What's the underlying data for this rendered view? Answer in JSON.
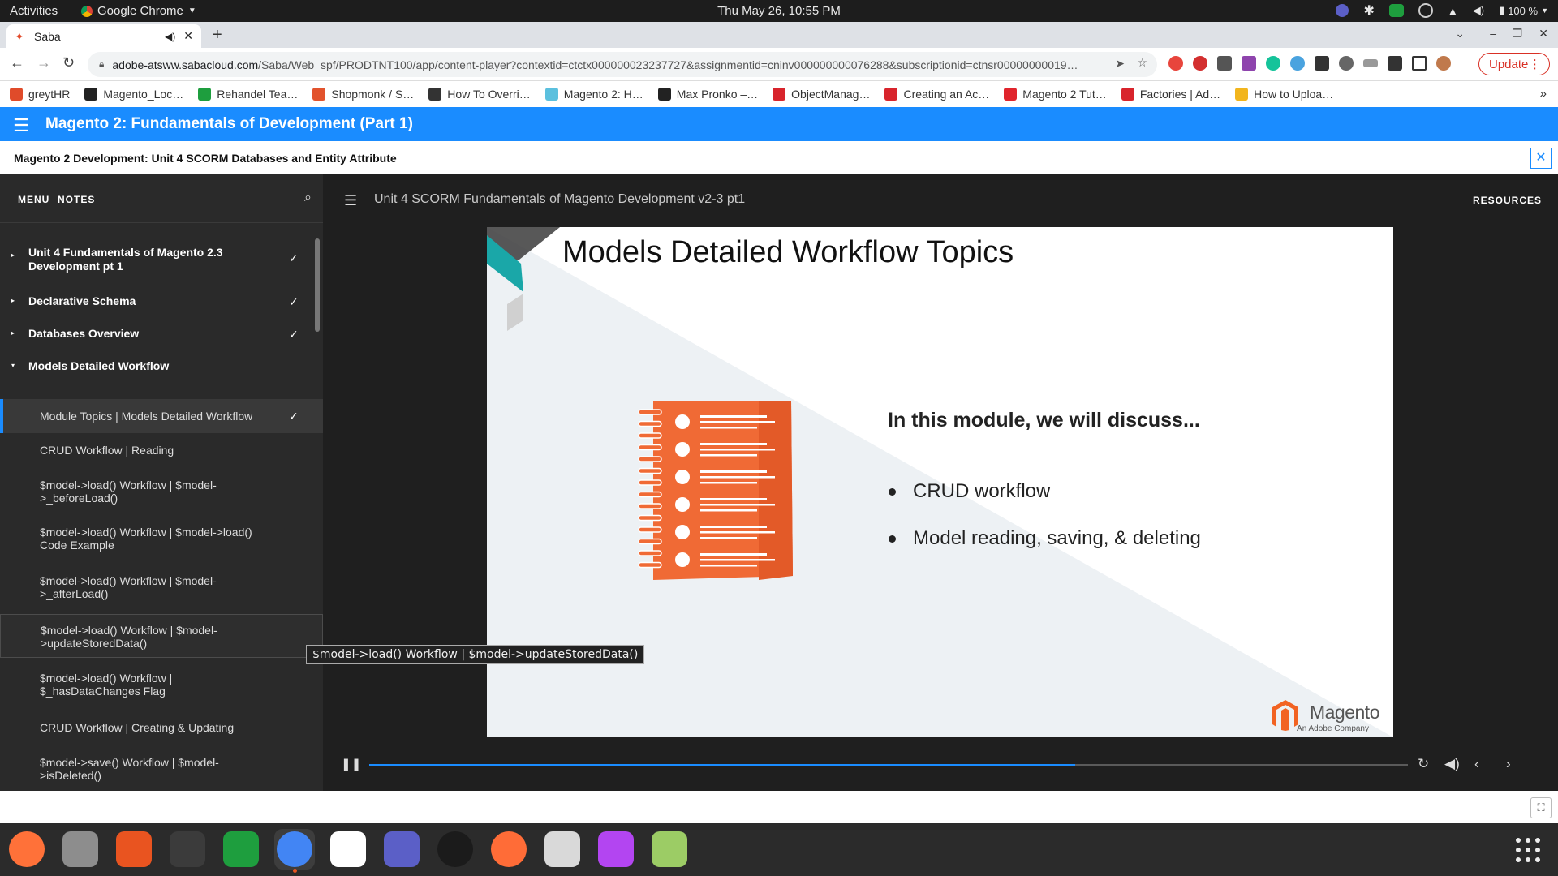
{
  "system": {
    "activities": "Activities",
    "app_name": "Google Chrome",
    "clock": "Thu May 26, 10:55 PM",
    "battery": "100 %"
  },
  "browser": {
    "tab_title": "Saba",
    "url_host": "adobe-atsww.sabacloud.com",
    "url_path": "/Saba/Web_spf/PRODTNT100/app/content-player?contextid=ctctx000000023237727&assignmentid=cninv000000000076288&subscriptionid=ctnsr00000000019…",
    "update_label": "Update",
    "bookmarks": [
      {
        "label": "greytHR",
        "color": "#e04b2a"
      },
      {
        "label": "Magento_Loc…",
        "color": "#222222"
      },
      {
        "label": "Rehandel Tea…",
        "color": "#1e9e3e"
      },
      {
        "label": "Shopmonk / S…",
        "color": "#e2532d"
      },
      {
        "label": "How To Overri…",
        "color": "#333333"
      },
      {
        "label": "Magento 2: H…",
        "color": "#5bc0de"
      },
      {
        "label": "Max Pronko –…",
        "color": "#222222"
      },
      {
        "label": "ObjectManag…",
        "color": "#d8242c"
      },
      {
        "label": "Creating an Ac…",
        "color": "#d8242c"
      },
      {
        "label": "Magento 2 Tut…",
        "color": "#e0242c"
      },
      {
        "label": "Factories | Ad…",
        "color": "#d8242c"
      },
      {
        "label": "How to Uploa…",
        "color": "#f2b51d"
      }
    ]
  },
  "course": {
    "title": "Magento 2: Fundamentals of Development (Part 1)",
    "module_title": "Magento 2 Development: Unit 4 SCORM Databases and Entity Attribute"
  },
  "sidebar": {
    "tab_menu": "MENU",
    "tab_notes": "NOTES",
    "sections": [
      {
        "label": "Unit 4 Fundamentals of Magento 2.3 Development pt 1",
        "caret": "▸",
        "check": "✓"
      },
      {
        "label": "Declarative Schema",
        "caret": "▸",
        "check": "✓"
      },
      {
        "label": "Databases Overview",
        "caret": "▸",
        "check": "✓"
      },
      {
        "label": "Models Detailed Workflow",
        "caret": "▾",
        "check": ""
      }
    ],
    "items": [
      {
        "label": "Module Topics | Models Detailed Workflow",
        "check": "✓"
      },
      {
        "label": "CRUD Workflow | Reading",
        "check": ""
      },
      {
        "label": "$model->load() Workflow | $model->_beforeLoad()",
        "check": ""
      },
      {
        "label": "$model->load() Workflow | $model->load() Code Example",
        "check": ""
      },
      {
        "label": "$model->load() Workflow | $model->_afterLoad()",
        "check": ""
      },
      {
        "label": "$model->load() Workflow | $model->updateStoredData()",
        "check": ""
      },
      {
        "label": "$model->load() Workflow | $_hasDataChanges Flag",
        "check": ""
      },
      {
        "label": "CRUD Workflow | Creating & Updating",
        "check": ""
      },
      {
        "label": "$model->save() Workflow | $model->isDeleted()",
        "check": ""
      }
    ]
  },
  "player": {
    "title": "Unit 4 SCORM Fundamentals of Magento Development v2-3 pt1",
    "resources": "RESOURCES",
    "progress_fraction": 0.68
  },
  "slide": {
    "title": "Models Detailed Workflow Topics",
    "subtitle": "In this module, we will discuss...",
    "bullets": [
      "CRUD workflow",
      "Model reading, saving, & deleting"
    ],
    "logo_text": "Magento",
    "logo_sub": "An Adobe Company",
    "accent_orange": "#f06a35",
    "accent_teal": "#1aa7a8"
  },
  "tooltip": "$model->load() Workflow | $model->updateStoredData()",
  "dock": [
    {
      "name": "firefox-icon",
      "color": "#ff7139",
      "running": false
    },
    {
      "name": "files-icon",
      "color": "#8d8d8d",
      "running": false
    },
    {
      "name": "software-icon",
      "color": "#e95420",
      "running": false
    },
    {
      "name": "terminal-icon",
      "color": "#3b3b3b",
      "running": false
    },
    {
      "name": "chat-icon",
      "color": "#1e9e3e",
      "running": false
    },
    {
      "name": "chrome-icon",
      "color": "#4285f4",
      "running": true
    },
    {
      "name": "slack-icon",
      "color": "#ffffff",
      "running": false
    },
    {
      "name": "teams-icon",
      "color": "#5b5fc7",
      "running": false
    },
    {
      "name": "camera-icon",
      "color": "#1b1b1b",
      "running": false
    },
    {
      "name": "postman-icon",
      "color": "#ff6c37",
      "running": false
    },
    {
      "name": "text-editor-icon",
      "color": "#d9d9d9",
      "running": false
    },
    {
      "name": "phpstorm-icon",
      "color": "#b345f1",
      "running": false
    },
    {
      "name": "image-viewer-icon",
      "color": "#9ccc65",
      "running": false
    }
  ]
}
